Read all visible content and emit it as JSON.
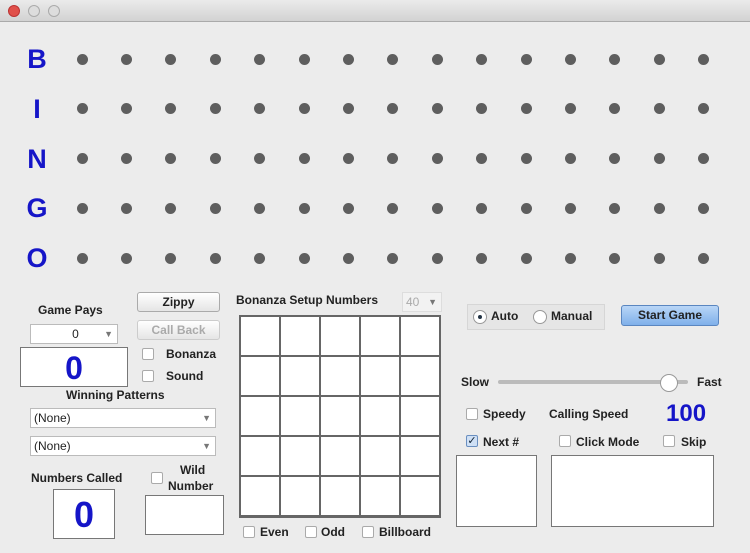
{
  "board": {
    "letters": [
      "B",
      "I",
      "N",
      "G",
      "O"
    ],
    "columns": 15
  },
  "left": {
    "game_pays_label": "Game Pays",
    "game_pays_value": "0",
    "game_pays_display": "0",
    "zippy_button": "Zippy",
    "call_back_button": "Call Back",
    "bonanza_label": "Bonanza",
    "sound_label": "Sound",
    "winning_patterns_label": "Winning Patterns",
    "pattern1": "(None)",
    "pattern2": "(None)",
    "numbers_called_label": "Numbers Called",
    "numbers_called_value": "0",
    "wild_label_1": "Wild",
    "wild_label_2": "Number"
  },
  "bonanza": {
    "title": "Bonanza Setup Numbers",
    "count": "40",
    "even_label": "Even",
    "odd_label": "Odd",
    "billboard_label": "Billboard"
  },
  "right": {
    "auto_label": "Auto",
    "manual_label": "Manual",
    "mode": "Auto",
    "start_button": "Start Game",
    "slow_label": "Slow",
    "fast_label": "Fast",
    "speed_fraction": 0.9,
    "speedy_label": "Speedy",
    "calling_speed_label": "Calling Speed",
    "calling_speed_value": "100",
    "next_label": "Next #",
    "next_checked": true,
    "click_mode_label": "Click Mode",
    "skip_label": "Skip"
  }
}
